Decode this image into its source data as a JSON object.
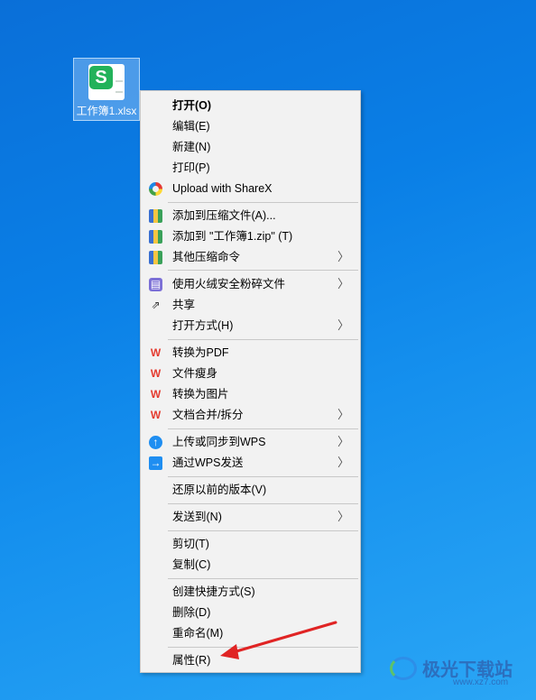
{
  "desktop": {
    "file": {
      "label": "工作簿1.xlsx",
      "badge": "S"
    }
  },
  "menu": {
    "items": [
      {
        "label": "打开(O)",
        "icon": "",
        "bold": true
      },
      {
        "label": "编辑(E)",
        "icon": ""
      },
      {
        "label": "新建(N)",
        "icon": ""
      },
      {
        "label": "打印(P)",
        "icon": ""
      },
      {
        "label": "Upload with ShareX",
        "icon": "sharex-icon"
      },
      {
        "label": "添加到压缩文件(A)...",
        "icon": "archive-icon"
      },
      {
        "label": "添加到 \"工作簿1.zip\" (T)",
        "icon": "archive-icon"
      },
      {
        "label": "其他压缩命令",
        "icon": "archive-icon",
        "submenu": true
      },
      {
        "label": "使用火绒安全粉碎文件",
        "icon": "shredder-icon",
        "submenu": true
      },
      {
        "label": "共享",
        "icon": "share-icon"
      },
      {
        "label": "打开方式(H)",
        "icon": "",
        "submenu": true
      },
      {
        "label": "转换为PDF",
        "icon": "wps-icon"
      },
      {
        "label": "文件瘦身",
        "icon": "wps-icon"
      },
      {
        "label": "转换为图片",
        "icon": "wps-icon"
      },
      {
        "label": "文档合并/拆分",
        "icon": "wps-icon",
        "submenu": true
      },
      {
        "label": "上传或同步到WPS",
        "icon": "cloud-upload-icon",
        "submenu": true
      },
      {
        "label": "通过WPS发送",
        "icon": "send-icon",
        "submenu": true
      },
      {
        "label": "还原以前的版本(V)",
        "icon": ""
      },
      {
        "label": "发送到(N)",
        "icon": "",
        "submenu": true
      },
      {
        "label": "剪切(T)",
        "icon": ""
      },
      {
        "label": "复制(C)",
        "icon": ""
      },
      {
        "label": "创建快捷方式(S)",
        "icon": ""
      },
      {
        "label": "删除(D)",
        "icon": ""
      },
      {
        "label": "重命名(M)",
        "icon": ""
      },
      {
        "label": "属性(R)",
        "icon": ""
      }
    ],
    "submenu_glyph": "〉"
  },
  "watermark": {
    "text": "极光下载站",
    "url": "www.xz7.com"
  },
  "colors": {
    "wps_red": "#e43b2f",
    "annotation_arrow": "#e02424"
  }
}
